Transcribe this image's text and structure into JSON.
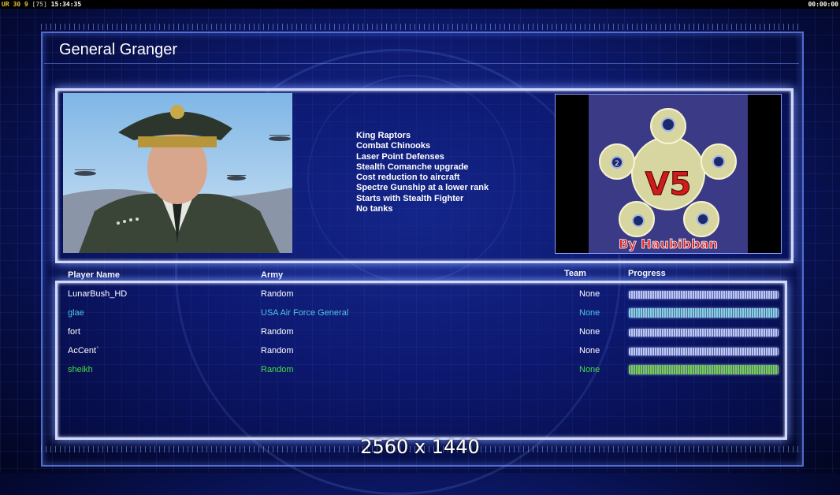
{
  "overlay": {
    "fps_label": "UR 30 9",
    "fps_bracket": "[75]",
    "clock": "15:34:35",
    "timer": "00:00:00"
  },
  "general": {
    "name": "General Granger",
    "features": [
      "King Raptors",
      "Combat Chinooks",
      "Laser Point Defenses",
      "Stealth Comanche upgrade",
      "Cost reduction to aircraft",
      "Spectre Gunship at a lower rank",
      "Starts with Stealth Fighter",
      "No tanks"
    ]
  },
  "map_preview": {
    "title": "V5",
    "author": "By Haubibban",
    "start_label": "2"
  },
  "table": {
    "headers": {
      "player_name": "Player Name",
      "army": "Army",
      "team": "Team",
      "progress": "Progress"
    },
    "rows": [
      {
        "name": "LunarBush_HD",
        "army": "Random",
        "team": "None",
        "color": "#ffffff",
        "bar": "#b9c6ff",
        "progress": 1.0
      },
      {
        "name": "glae",
        "army": "USA Air Force General",
        "team": "None",
        "color": "#4fc3e8",
        "bar": "#7fd3ea",
        "progress": 1.0
      },
      {
        "name": "fort",
        "army": "Random",
        "team": "None",
        "color": "#ffffff",
        "bar": "#b9c6ff",
        "progress": 1.0
      },
      {
        "name": "AcCent`",
        "army": "Random",
        "team": "None",
        "color": "#ffffff",
        "bar": "#b9c6ff",
        "progress": 1.0
      },
      {
        "name": "sheikh",
        "army": "Random",
        "team": "None",
        "color": "#44dd44",
        "bar": "#6fd24a",
        "progress": 1.0
      }
    ]
  },
  "resolution_label": "2560 x 1440"
}
